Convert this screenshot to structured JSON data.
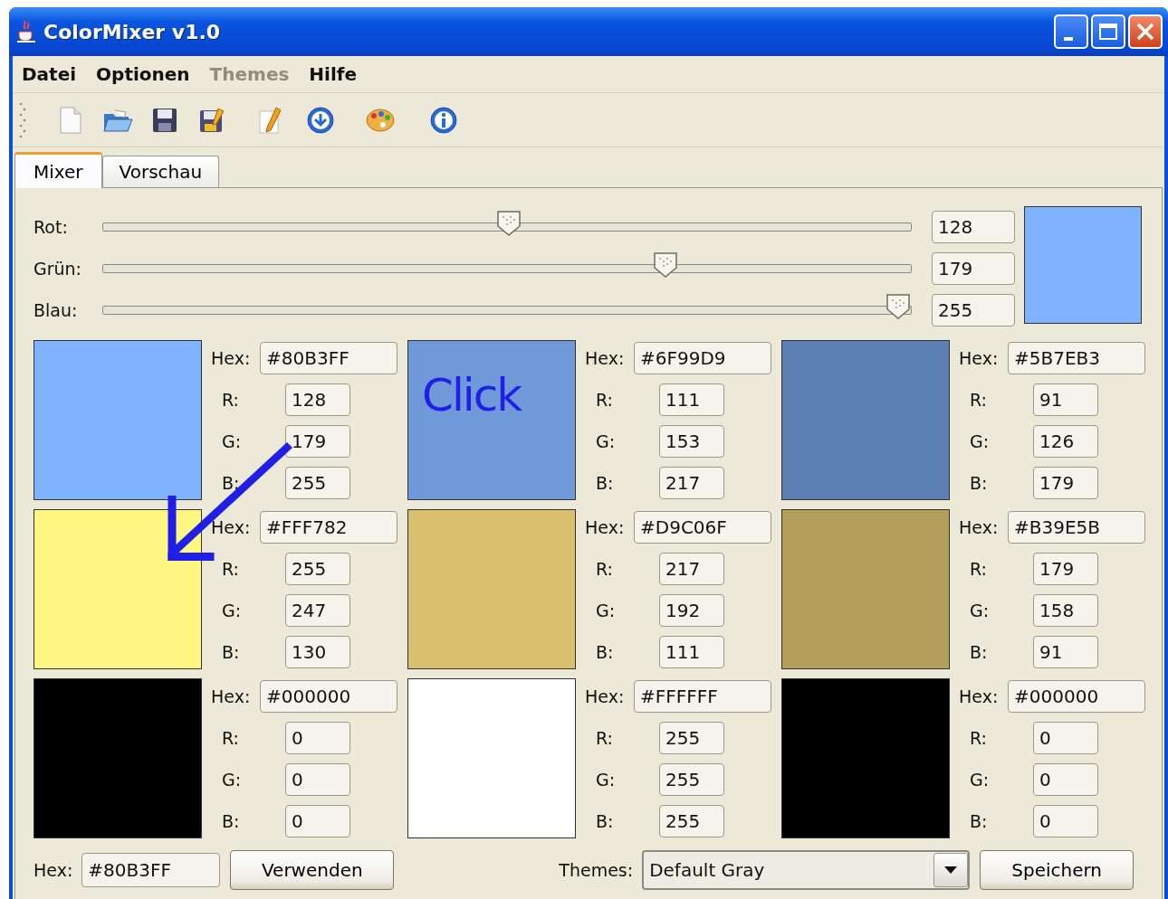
{
  "window": {
    "title": "ColorMixer v1.0"
  },
  "menu": [
    {
      "label": "Datei",
      "disabled": false
    },
    {
      "label": "Optionen",
      "disabled": false
    },
    {
      "label": "Themes",
      "disabled": true
    },
    {
      "label": "Hilfe",
      "disabled": false
    }
  ],
  "tabs": [
    {
      "label": "Mixer",
      "selected": true
    },
    {
      "label": "Vorschau",
      "selected": false
    }
  ],
  "sliders": [
    {
      "label": "Rot:",
      "level": 0.502,
      "value": "128"
    },
    {
      "label": "Grün:",
      "level": 0.702,
      "value": "179"
    },
    {
      "label": "Blau:",
      "level": 1.0,
      "value": "255"
    }
  ],
  "preview": {
    "color": "#80b3ff"
  },
  "swatches": [
    {
      "color": "#80b3ff",
      "hex_label": "Hex:",
      "hex": "#80B3FF",
      "r_label": "R:",
      "r": "128",
      "g_label": "G:",
      "g": "179",
      "b_label": "B:",
      "b": "255"
    },
    {
      "color": "#6f99d9",
      "hex_label": "Hex:",
      "hex": "#6F99D9",
      "r_label": "R:",
      "r": "111",
      "g_label": "G:",
      "g": "153",
      "b_label": "B:",
      "b": "217"
    },
    {
      "color": "#5b7eb3",
      "hex_label": "Hex:",
      "hex": "#5B7EB3",
      "r_label": "R:",
      "r": "91",
      "g_label": "G:",
      "g": "126",
      "b_label": "B:",
      "b": "179"
    },
    {
      "color": "#fff782",
      "hex_label": "Hex:",
      "hex": "#FFF782",
      "r_label": "R:",
      "r": "255",
      "g_label": "G:",
      "g": "247",
      "b_label": "B:",
      "b": "130"
    },
    {
      "color": "#d9c06f",
      "hex_label": "Hex:",
      "hex": "#D9C06F",
      "r_label": "R:",
      "r": "217",
      "g_label": "G:",
      "g": "192",
      "b_label": "B:",
      "b": "111"
    },
    {
      "color": "#b39e5b",
      "hex_label": "Hex:",
      "hex": "#B39E5B",
      "r_label": "R:",
      "r": "179",
      "g_label": "G:",
      "g": "158",
      "b_label": "B:",
      "b": "91"
    },
    {
      "color": "#000000",
      "hex_label": "Hex:",
      "hex": "#000000",
      "r_label": "R:",
      "r": "0",
      "g_label": "G:",
      "g": "0",
      "b_label": "B:",
      "b": "0"
    },
    {
      "color": "#ffffff",
      "hex_label": "Hex:",
      "hex": "#FFFFFF",
      "r_label": "R:",
      "r": "255",
      "g_label": "G:",
      "g": "255",
      "b_label": "B:",
      "b": "255"
    },
    {
      "color": "#000000",
      "hex_label": "Hex:",
      "hex": "#000000",
      "r_label": "R:",
      "r": "0",
      "g_label": "G:",
      "g": "0",
      "b_label": "B:",
      "b": "0"
    }
  ],
  "bottom": {
    "hex_label": "Hex:",
    "hex_value": "#80B3FF",
    "apply_button": "Verwenden",
    "themes_label": "Themes:",
    "theme_select": "Default Gray",
    "save_button": "Speichern"
  },
  "annotation": {
    "text": "Click"
  }
}
